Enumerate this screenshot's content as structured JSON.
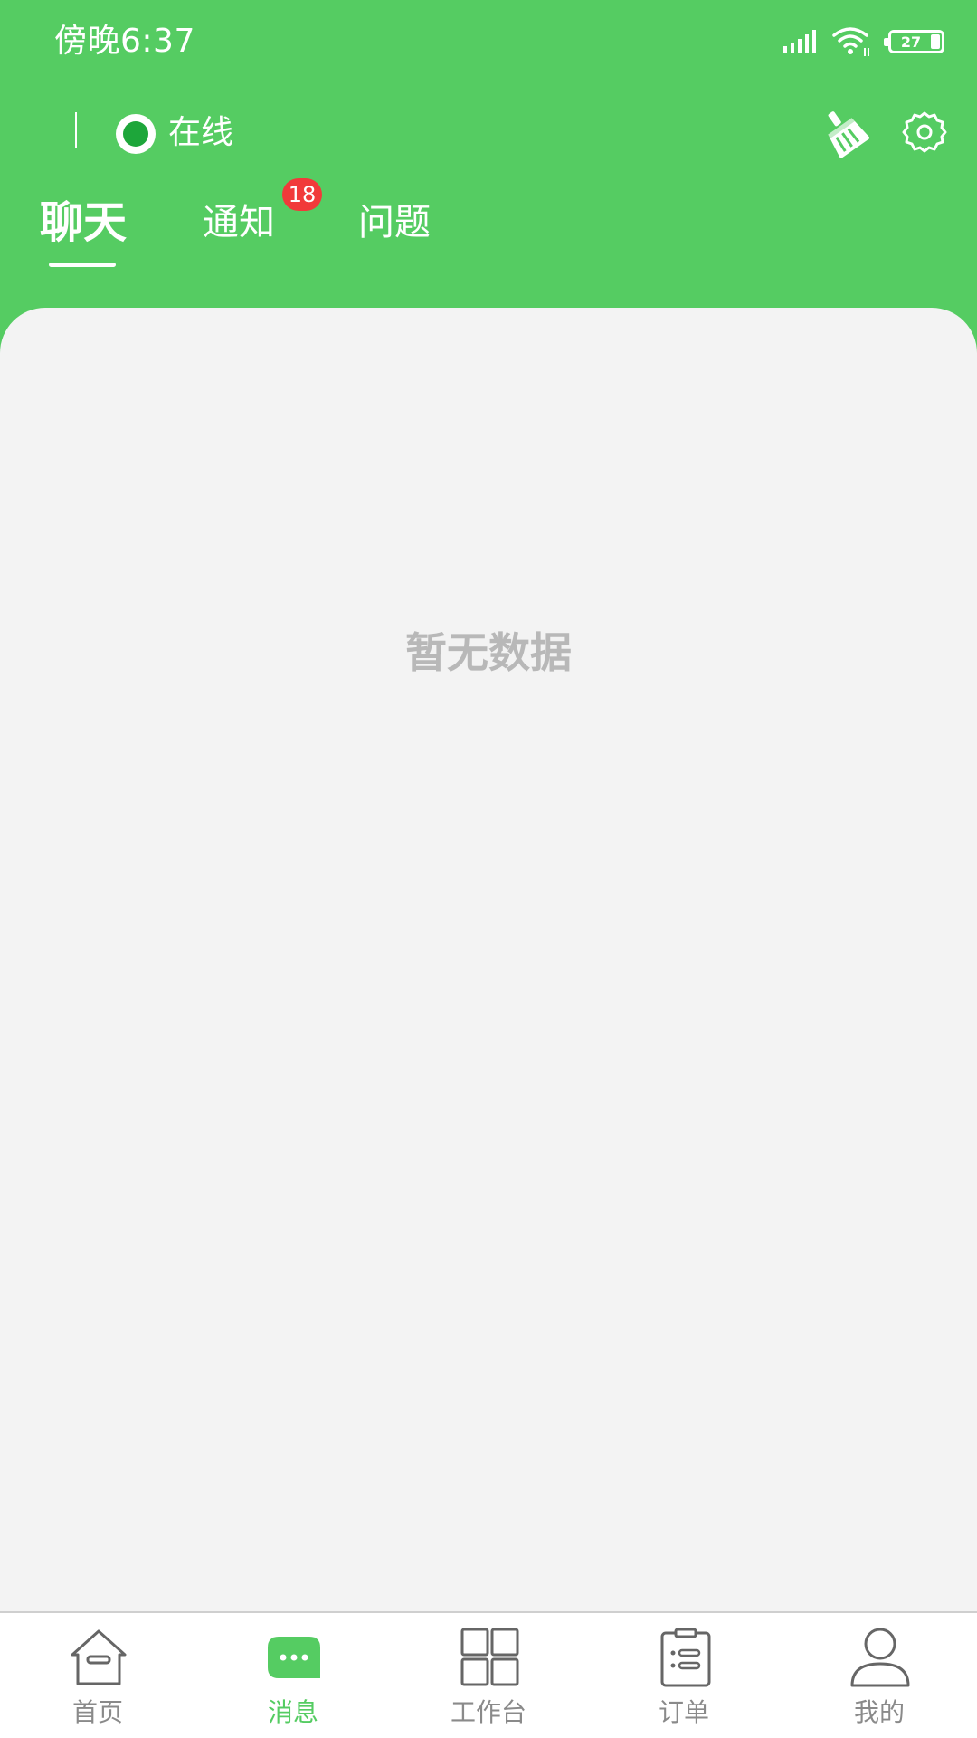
{
  "status_bar": {
    "time": "傍晚6:37",
    "battery_level": "27",
    "icons": [
      "signal-icon",
      "wifi-icon",
      "battery-icon"
    ]
  },
  "header": {
    "status_label": "在线",
    "icons": [
      "broom-icon",
      "gear-icon"
    ]
  },
  "tabs": {
    "chat": "聊天",
    "notice": "通知",
    "notice_badge": "18",
    "issue": "问题",
    "active": "chat"
  },
  "content": {
    "empty_text": "暂无数据"
  },
  "tabbar": {
    "active": "messages",
    "items": [
      {
        "key": "home",
        "label": "首页",
        "icon": "home-icon"
      },
      {
        "key": "messages",
        "label": "消息",
        "icon": "chat-bubble-icon"
      },
      {
        "key": "workbench",
        "label": "工作台",
        "icon": "grid-icon"
      },
      {
        "key": "orders",
        "label": "订单",
        "icon": "clipboard-icon"
      },
      {
        "key": "mine",
        "label": "我的",
        "icon": "user-icon"
      }
    ]
  },
  "colors": {
    "brand_green": "#55cc62",
    "online_green": "#1da63a",
    "badge_red": "#f13a3a",
    "background_gray": "#f3f3f3"
  }
}
